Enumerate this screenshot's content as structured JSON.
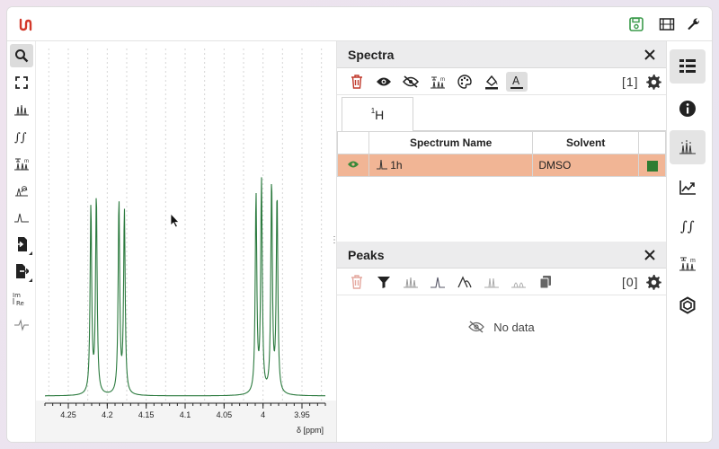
{
  "topbar": {
    "icons": [
      "logo-icon",
      "save-icon",
      "film-icon",
      "wrench-icon"
    ]
  },
  "left_toolbar": {
    "tools": [
      "zoom-icon",
      "full-screen-icon",
      "peak-picking-icon",
      "integral-icon",
      "multiplet-icon",
      "phase-correction-icon",
      "baseline-icon",
      "import-icon",
      "export-icon",
      "real-imaginary-icon",
      "spectrum-display-icon"
    ]
  },
  "plot": {
    "x_unit_label": "δ [ppm]",
    "line_color": "#2b7a3e"
  },
  "chart_data": {
    "type": "line",
    "title": "",
    "xlabel": "δ [ppm]",
    "ylabel": "",
    "xlim": [
      4.28,
      3.92
    ],
    "x_reversed": true,
    "tick_labels": [
      "4.25",
      "4.2",
      "4.15",
      "4.1",
      "4.05",
      "4",
      "3.95"
    ],
    "tick_values": [
      4.25,
      4.2,
      4.15,
      4.1,
      4.05,
      4.0,
      3.95
    ],
    "peaks": [
      {
        "ppm": 4.221,
        "height": 0.73
      },
      {
        "ppm": 4.214,
        "height": 0.77
      },
      {
        "ppm": 4.185,
        "height": 0.75
      },
      {
        "ppm": 4.178,
        "height": 0.71
      },
      {
        "ppm": 4.009,
        "height": 0.77
      },
      {
        "ppm": 4.002,
        "height": 0.82
      },
      {
        "ppm": 3.989,
        "height": 0.82
      },
      {
        "ppm": 3.982,
        "height": 0.77
      }
    ],
    "grid": true
  },
  "spectra_panel": {
    "title": "Spectra",
    "count": "[1]",
    "tab": {
      "sup": "1",
      "label": "H"
    },
    "columns": [
      "Spectrum Name",
      "Solvent"
    ],
    "rows": [
      {
        "name": "1h",
        "solvent": "DMSO",
        "color": "#2e7d32",
        "visible": true
      }
    ],
    "row_highlight": "#f1b595"
  },
  "peaks_panel": {
    "title": "Peaks",
    "count": "[0]",
    "empty_text": "No data"
  },
  "right_bar": {
    "items": [
      "spectra-panel-icon",
      "information-icon",
      "peaks-panel-icon",
      "chart-trend-icon",
      "integrals-panel-icon",
      "multiplets-panel-icon",
      "structure-icon"
    ]
  }
}
